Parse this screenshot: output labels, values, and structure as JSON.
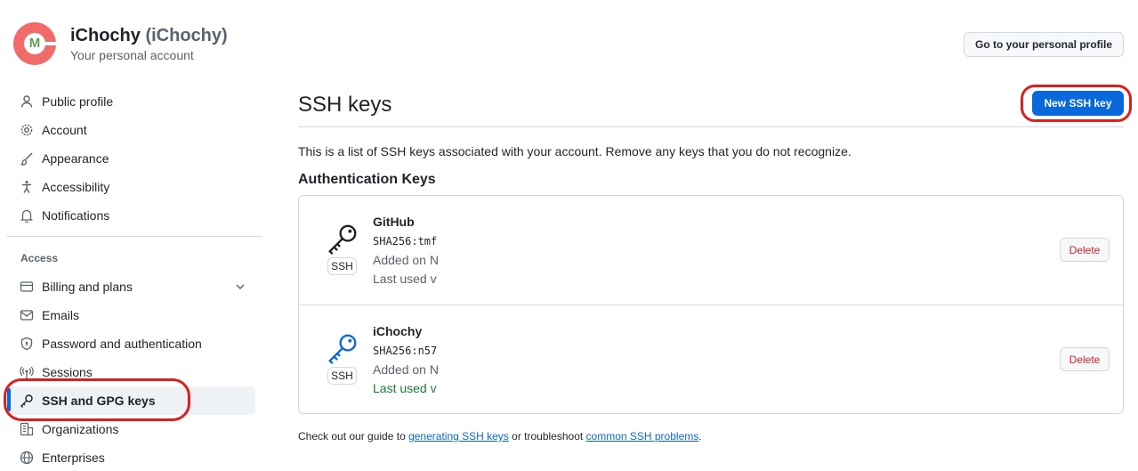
{
  "header": {
    "avatar_letter": "M",
    "user_display": "iChochy",
    "user_handle": "(iChochy)",
    "subtitle": "Your personal account",
    "profile_button": "Go to your personal profile"
  },
  "sidebar": {
    "items": [
      {
        "label": "Public profile",
        "icon": "person-icon"
      },
      {
        "label": "Account",
        "icon": "gear-icon"
      },
      {
        "label": "Appearance",
        "icon": "paintbrush-icon"
      },
      {
        "label": "Accessibility",
        "icon": "accessibility-icon"
      },
      {
        "label": "Notifications",
        "icon": "bell-icon"
      }
    ],
    "section_label": "Access",
    "access_items": [
      {
        "label": "Billing and plans",
        "icon": "credit-card-icon"
      },
      {
        "label": "Emails",
        "icon": "mail-icon"
      },
      {
        "label": "Password and authentication",
        "icon": "shield-lock-icon"
      },
      {
        "label": "Sessions",
        "icon": "broadcast-icon"
      },
      {
        "label": "SSH and GPG keys",
        "icon": "key-icon"
      },
      {
        "label": "Organizations",
        "icon": "organization-icon"
      },
      {
        "label": "Enterprises",
        "icon": "globe-icon"
      }
    ]
  },
  "main": {
    "title": "SSH keys",
    "new_button": "New SSH key",
    "intro": "This is a list of SSH keys associated with your account. Remove any keys that you do not recognize.",
    "section_heading": "Authentication Keys",
    "keys": [
      {
        "title": "GitHub",
        "fingerprint": "SHA256:tmf",
        "added": "Added on N",
        "last_used": "Last used v",
        "badge": "SSH",
        "delete": "Delete"
      },
      {
        "title": "iChochy",
        "fingerprint": "SHA256:n57",
        "added": "Added on N",
        "last_used": "Last used v",
        "badge": "SSH",
        "delete": "Delete"
      }
    ],
    "footer": {
      "prefix": "Check out our guide to ",
      "link1": "generating SSH keys",
      "middle": " or troubleshoot ",
      "link2": "common SSH problems",
      "suffix": "."
    }
  },
  "colors": {
    "accent": "#0969da",
    "danger": "#d1242f",
    "success": "#1a7f37",
    "annotation": "#e01e1e"
  }
}
